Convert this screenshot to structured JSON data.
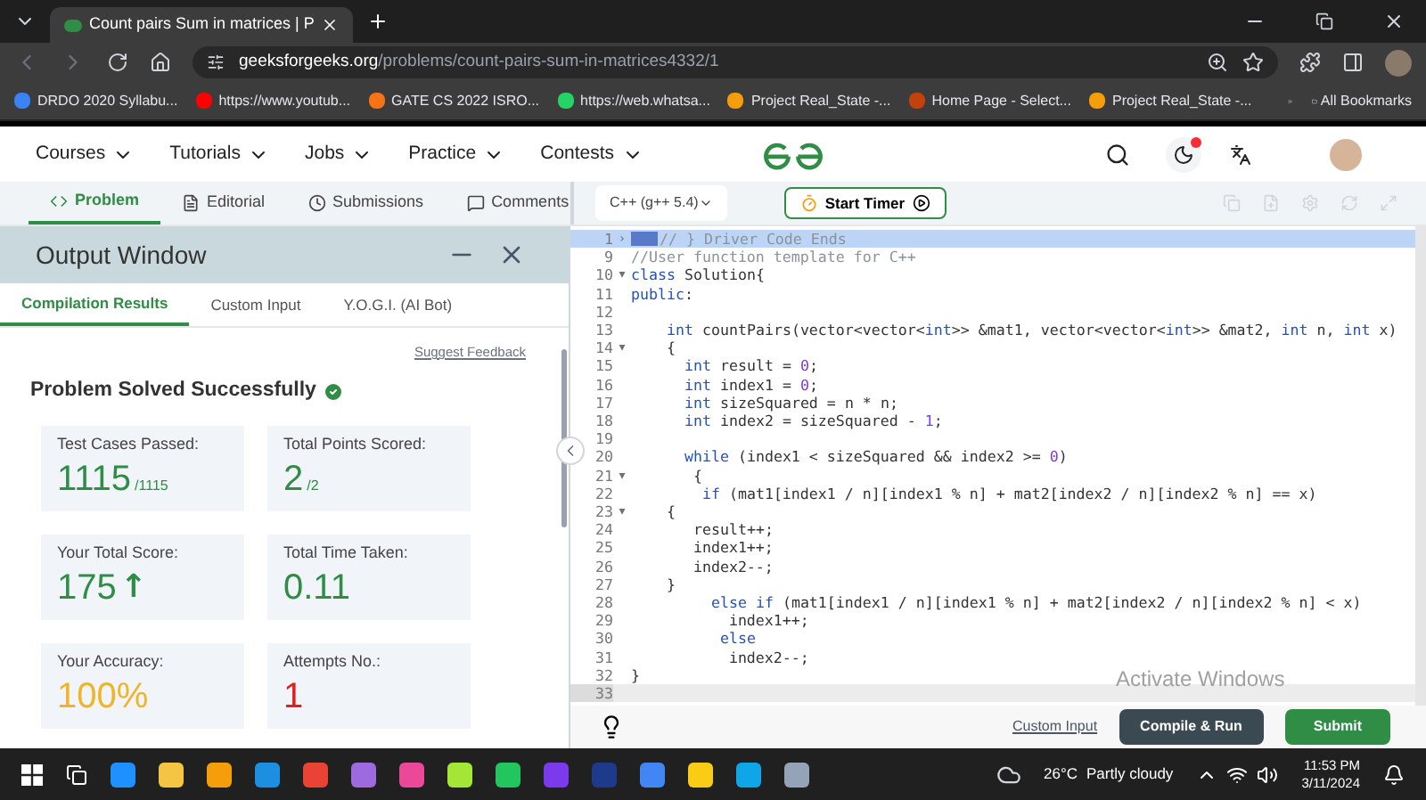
{
  "browser": {
    "tab_title": "Count pairs Sum in matrices | P",
    "url_domain": "geeksforgeeks.org",
    "url_path": "/problems/count-pairs-sum-in-matrices4332/1",
    "bookmarks": [
      {
        "label": "DRDO 2020 Syllabu...",
        "color": "#3b82f6"
      },
      {
        "label": "https://www.youtub...",
        "color": "#ff0000"
      },
      {
        "label": "GATE CS 2022 ISRO...",
        "color": "#f97316"
      },
      {
        "label": "https://web.whatsa...",
        "color": "#25d366"
      },
      {
        "label": "Project Real_State -...",
        "color": "#f59e0b"
      },
      {
        "label": "Home Page - Select...",
        "color": "#c2410c"
      },
      {
        "label": "Project Real_State -...",
        "color": "#f59e0b"
      }
    ],
    "all_bookmarks": "All Bookmarks"
  },
  "nav": {
    "items": [
      "Courses",
      "Tutorials",
      "Jobs",
      "Practice",
      "Contests"
    ]
  },
  "subtabs": [
    {
      "label": "Problem",
      "selected": true
    },
    {
      "label": "Editorial",
      "selected": false
    },
    {
      "label": "Submissions",
      "selected": false
    },
    {
      "label": "Comments",
      "selected": false
    }
  ],
  "output": {
    "title": "Output Window",
    "tabs": [
      {
        "label": "Compilation Results",
        "selected": true
      },
      {
        "label": "Custom Input",
        "selected": false
      },
      {
        "label": "Y.O.G.I. (AI Bot)",
        "selected": false
      }
    ],
    "feedback": "Suggest Feedback",
    "status": "Problem Solved Successfully",
    "cards": [
      {
        "label": "Test Cases Passed:",
        "value": "1115",
        "suffix": "/1115",
        "color": "#2f8d46"
      },
      {
        "label": "Total Points Scored:",
        "value": "2",
        "suffix": "/2",
        "color": "#2f8d46"
      },
      {
        "label": "Your Total Score:",
        "value": "175",
        "trend": "↑",
        "color": "#2f8d46"
      },
      {
        "label": "Total Time Taken:",
        "value": "0.11",
        "color": "#2f8d46"
      },
      {
        "label": "Your Accuracy:",
        "value": "100%",
        "color": "#f0b429"
      },
      {
        "label": "Attempts No.:",
        "value": "1",
        "color": "#e0201b"
      }
    ]
  },
  "editor": {
    "language": "C++ (g++ 5.4)",
    "timer": "Start Timer",
    "lines": [
      {
        "n": "1",
        "text": "// } Driver Code Ends",
        "fold": "›",
        "folded": true,
        "selected": true,
        "current": false
      },
      {
        "n": "9",
        "text": "//User function template for C++",
        "selected": false,
        "current": false
      },
      {
        "n": "10",
        "text": "class Solution{",
        "fold": "▾",
        "selected": false,
        "current": false
      },
      {
        "n": "11",
        "text": "public:",
        "selected": false,
        "current": false
      },
      {
        "n": "12",
        "selected": false,
        "current": false
      },
      {
        "n": "13",
        "text": "    int countPairs(vector<vector<int>> &mat1, vector<vector<int>> &mat2, int n, int x)",
        "selected": false,
        "current": false
      },
      {
        "n": "14",
        "text": "    {",
        "fold": "▾",
        "selected": false,
        "current": false
      },
      {
        "n": "15",
        "text": "      int result = 0;",
        "selected": false,
        "current": false
      },
      {
        "n": "16",
        "text": "      int index1 = 0;",
        "selected": false,
        "current": false
      },
      {
        "n": "17",
        "text": "      int sizeSquared = n * n;",
        "selected": false,
        "current": false
      },
      {
        "n": "18",
        "text": "      int index2 = sizeSquared - 1;",
        "selected": false,
        "current": false
      },
      {
        "n": "19",
        "selected": false,
        "current": false
      },
      {
        "n": "20",
        "text": "      while (index1 < sizeSquared && index2 >= 0)",
        "selected": false,
        "current": false
      },
      {
        "n": "21",
        "text": "       {",
        "fold": "▾",
        "selected": false,
        "current": false
      },
      {
        "n": "22",
        "text": "        if (mat1[index1 / n][index1 % n] + mat2[index2 / n][index2 % n] == x)",
        "selected": false,
        "current": false
      },
      {
        "n": "23",
        "text": "    {",
        "fold": "▾",
        "selected": false,
        "current": false
      },
      {
        "n": "24",
        "text": "       result++;",
        "selected": false,
        "current": false
      },
      {
        "n": "25",
        "text": "       index1++;",
        "selected": false,
        "current": false
      },
      {
        "n": "26",
        "text": "       index2--;",
        "selected": false,
        "current": false
      },
      {
        "n": "27",
        "text": "    }",
        "selected": false,
        "current": false
      },
      {
        "n": "28",
        "text": "         else if (mat1[index1 / n][index1 % n] + mat2[index2 / n][index2 % n] < x)",
        "selected": false,
        "current": false
      },
      {
        "n": "29",
        "text": "           index1++;",
        "selected": false,
        "current": false
      },
      {
        "n": "30",
        "text": "          else",
        "selected": false,
        "current": false
      },
      {
        "n": "31",
        "text": "           index2--;",
        "selected": false,
        "current": false
      },
      {
        "n": "32",
        "text": "}",
        "selected": false,
        "current": false
      },
      {
        "n": "33",
        "selected": false,
        "current": true
      }
    ],
    "custom_input": "Custom Input",
    "compile": "Compile & Run",
    "submit": "Submit"
  },
  "watermark": {
    "title": "Activate Windows"
  },
  "taskbar": {
    "temperature": "26°C",
    "weather": "Partly cloudy",
    "time": "11:53 PM",
    "date": "3/11/2024"
  }
}
